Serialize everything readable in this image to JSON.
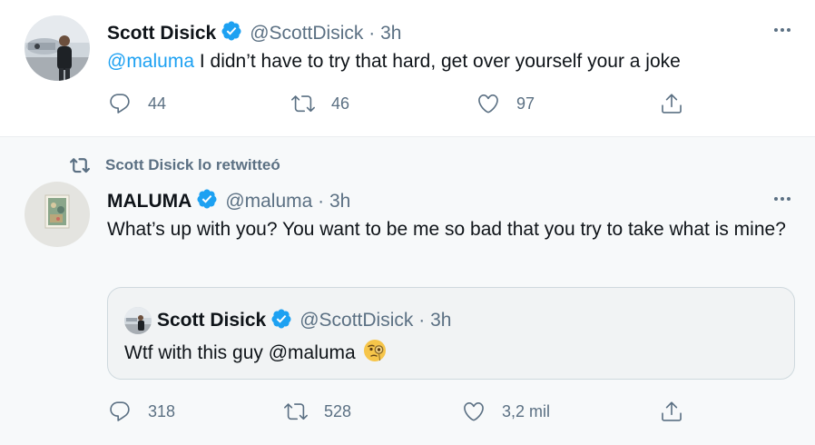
{
  "tweet": {
    "author": "Scott Disick",
    "handle": "@ScottDisick",
    "time": "3h",
    "mention": "@maluma",
    "text": " I didn’t have to try that hard, get over yourself your a joke",
    "replies": "44",
    "retweets": "46",
    "likes": "97"
  },
  "retweeted_tweet": {
    "retweet_label": "Scott Disick lo retwitteó",
    "author": "MALUMA",
    "handle": "@maluma",
    "time": "3h",
    "text": "What’s up with you? You want to be me so bad that you try to take what is mine?",
    "replies": "318",
    "retweets": "528",
    "likes": "3,2 mil",
    "quote": {
      "author": "Scott Disick",
      "handle": "@ScottDisick",
      "time": "3h",
      "text": "Wtf with this guy @maluma"
    }
  },
  "colors": {
    "verified": "#1da1f2",
    "secondary_text": "#5b7083",
    "mention": "#1da1f2"
  }
}
